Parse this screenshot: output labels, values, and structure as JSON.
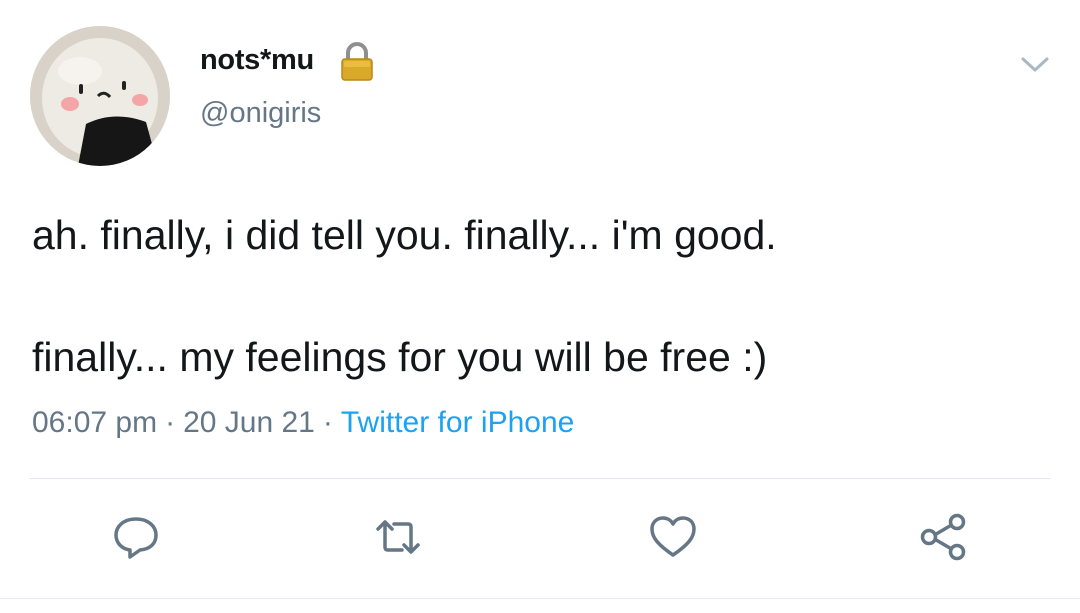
{
  "user": {
    "display_name": "nots*mu",
    "handle": "@onigiris",
    "avatar_icon": "onigiri-avatar",
    "protected_icon": "lock-icon"
  },
  "tweet": {
    "line1": "ah. finally, i did tell you. finally... i'm good.",
    "line2": "finally... my feelings for you will be free :)"
  },
  "meta": {
    "time": "06:07 pm",
    "separator": "·",
    "date": "20 Jun 21",
    "source": "Twitter for iPhone"
  },
  "colors": {
    "text": "#14171a",
    "secondary": "#657786",
    "accent": "#1da1f2",
    "divider": "#e1e8ed"
  },
  "actions": [
    {
      "name": "reply",
      "icon": "comment-icon"
    },
    {
      "name": "retweet",
      "icon": "retweet-icon"
    },
    {
      "name": "like",
      "icon": "heart-icon"
    },
    {
      "name": "share",
      "icon": "share-icon"
    }
  ]
}
